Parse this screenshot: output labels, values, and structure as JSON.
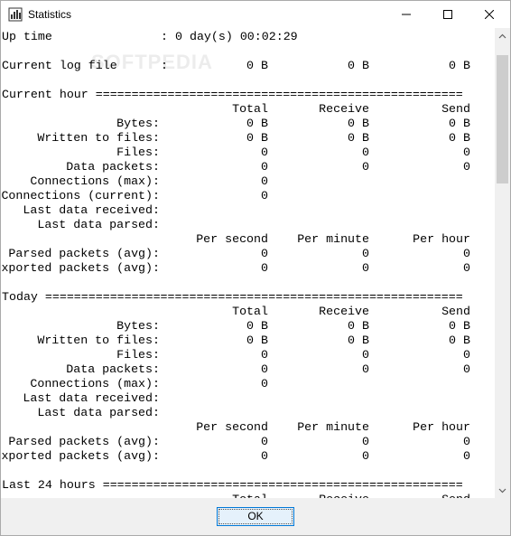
{
  "window": {
    "title": "Statistics"
  },
  "watermark": "SOFTPEDIA",
  "uptime": {
    "label": "Up time",
    "sep": ":",
    "value": "0 day(s) 00:02:29"
  },
  "current_log_file": {
    "label": "Current log file",
    "sep": ":",
    "v1": "0 B",
    "v2": "0 B",
    "v3": "0 B"
  },
  "sections": [
    {
      "header": "Current hour ===================================================",
      "col_headers": [
        "Total",
        "Receive",
        "Send"
      ],
      "rows": [
        {
          "label": "Bytes:",
          "v": [
            "0 B",
            "0 B",
            "0 B"
          ]
        },
        {
          "label": "Written to files:",
          "v": [
            "0 B",
            "0 B",
            "0 B"
          ]
        },
        {
          "label": "Files:",
          "v": [
            "0",
            "0",
            "0"
          ]
        },
        {
          "label": "Data packets:",
          "v": [
            "0",
            "0",
            "0"
          ]
        },
        {
          "label": "Connections (max):",
          "v": [
            "0",
            "",
            ""
          ]
        },
        {
          "label": "Connections (current):",
          "v": [
            "0",
            "",
            ""
          ]
        },
        {
          "label": "Last data received:",
          "v": [
            "",
            "",
            ""
          ]
        },
        {
          "label": "Last data parsed:",
          "v": [
            "",
            "",
            ""
          ]
        }
      ],
      "rate_headers": [
        "Per second",
        "Per minute",
        "Per hour"
      ],
      "rate_rows": [
        {
          "label": "Parsed packets (avg):",
          "v": [
            "0",
            "0",
            "0"
          ]
        },
        {
          "label": "Exported packets (avg):",
          "v": [
            "0",
            "0",
            "0"
          ]
        }
      ]
    },
    {
      "header": "Today ==========================================================",
      "col_headers": [
        "Total",
        "Receive",
        "Send"
      ],
      "rows": [
        {
          "label": "Bytes:",
          "v": [
            "0 B",
            "0 B",
            "0 B"
          ]
        },
        {
          "label": "Written to files:",
          "v": [
            "0 B",
            "0 B",
            "0 B"
          ]
        },
        {
          "label": "Files:",
          "v": [
            "0",
            "0",
            "0"
          ]
        },
        {
          "label": "Data packets:",
          "v": [
            "0",
            "0",
            "0"
          ]
        },
        {
          "label": "Connections (max):",
          "v": [
            "0",
            "",
            ""
          ]
        },
        {
          "label": "Last data received:",
          "v": [
            "",
            "",
            ""
          ]
        },
        {
          "label": "Last data parsed:",
          "v": [
            "",
            "",
            ""
          ]
        }
      ],
      "rate_headers": [
        "Per second",
        "Per minute",
        "Per hour"
      ],
      "rate_rows": [
        {
          "label": "Parsed packets (avg):",
          "v": [
            "0",
            "0",
            "0"
          ]
        },
        {
          "label": "Exported packets (avg):",
          "v": [
            "0",
            "0",
            "0"
          ]
        }
      ]
    },
    {
      "header": "Last 24 hours ==================================================",
      "col_headers": [
        "Total",
        "Receive",
        "Send"
      ],
      "rows": [],
      "rate_headers": [],
      "rate_rows": []
    }
  ],
  "footer": {
    "ok_label": "OK"
  }
}
